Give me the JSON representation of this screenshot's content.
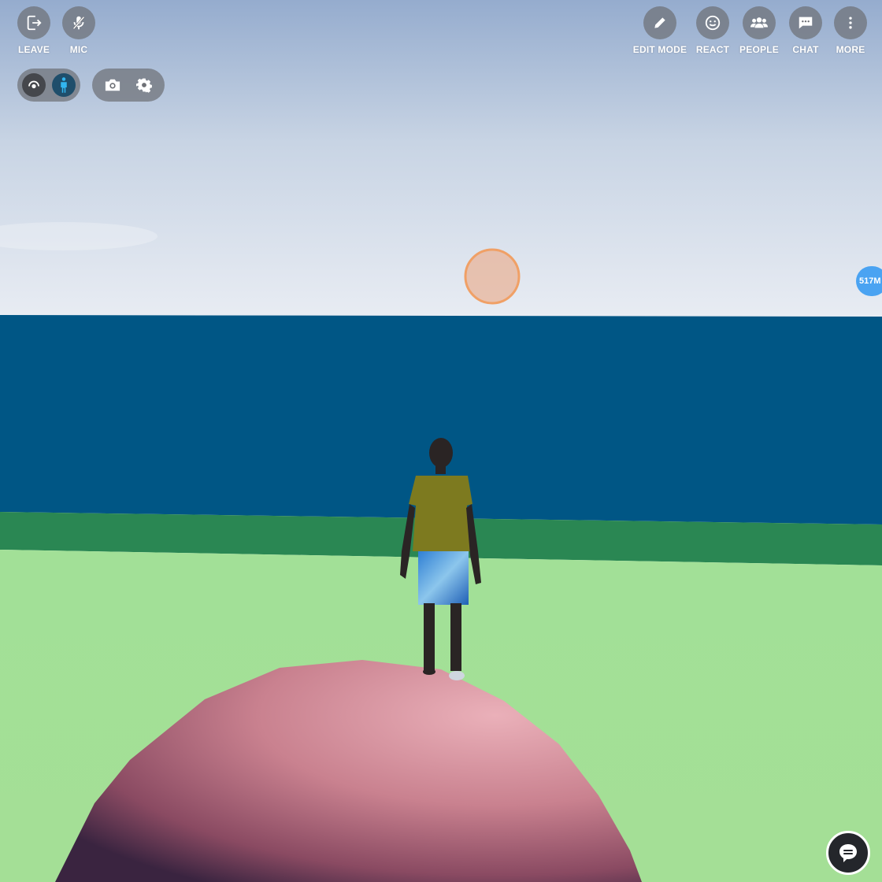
{
  "toolbar_left": {
    "leave_label": "LEAVE",
    "mic_label": "MIC"
  },
  "toolbar_right": {
    "edit_mode_label": "EDIT MODE",
    "react_label": "REACT",
    "people_label": "PEOPLE",
    "chat_label": "CHAT",
    "more_label": "MORE"
  },
  "view_controls": {
    "orbit_icon": "orbit-view-icon",
    "avatar_icon": "avatar-view-icon",
    "camera_icon": "camera-icon",
    "settings_icon": "gear-icon"
  },
  "side_badge": {
    "text": "517M"
  },
  "chat_fab": {
    "icon": "chat-bubble-icon"
  },
  "colors": {
    "sky_top": "#9db3d1",
    "sky_bottom": "#e6ebf3",
    "ocean": "#005685",
    "shore": "#2a8753",
    "grass": "#a0df94",
    "sphere": "#c8808e",
    "badge": "#4aa3f2"
  }
}
